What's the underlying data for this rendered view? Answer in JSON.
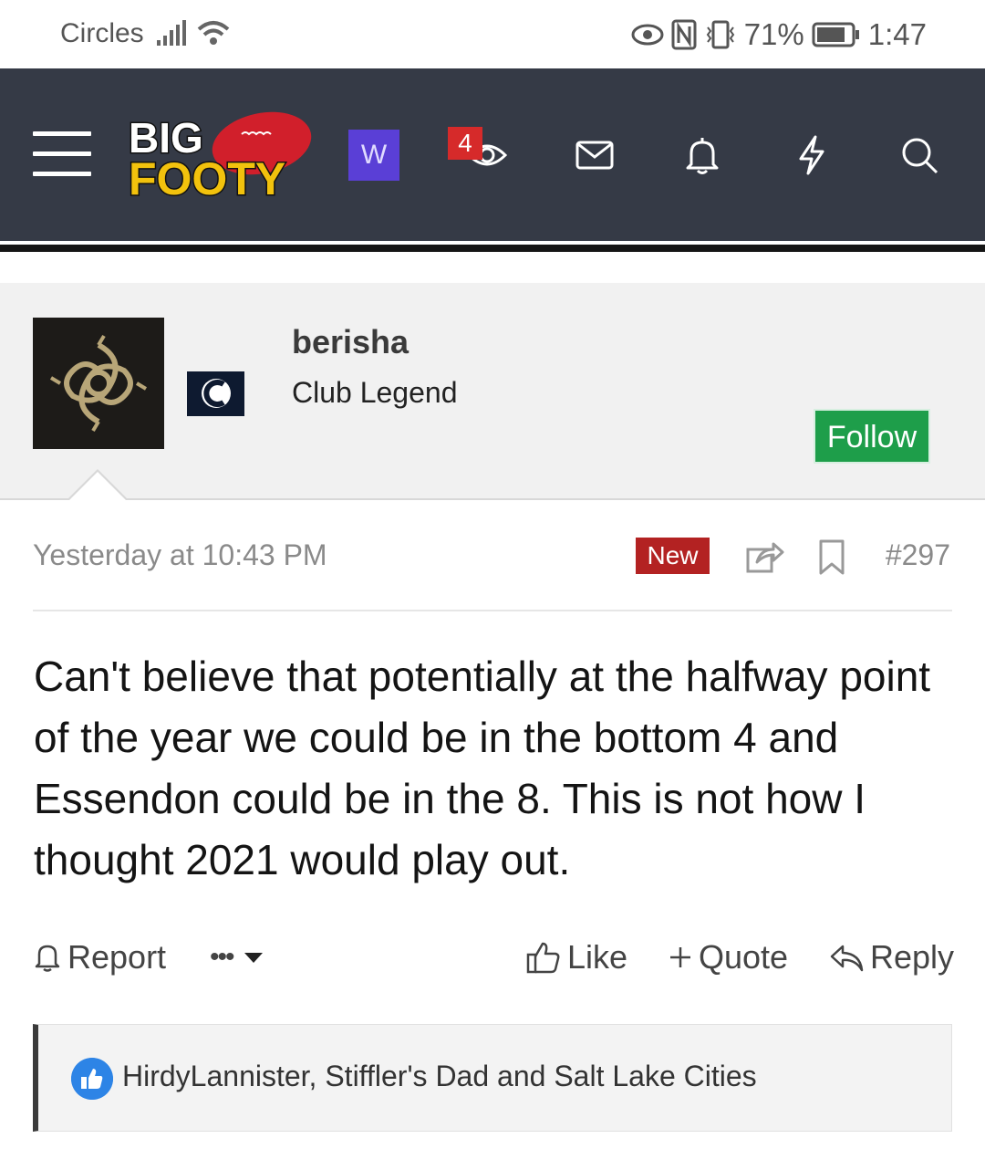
{
  "status_bar": {
    "carrier": "Circles",
    "battery": "71%",
    "time": "1:47"
  },
  "header": {
    "logo_text_top": "BIG",
    "logo_text_bottom": "FOOTY",
    "w_badge": "W",
    "watched_count": "4",
    "icons": [
      "menu-icon",
      "eye-icon",
      "envelope-icon",
      "bell-icon",
      "lightning-icon",
      "search-icon"
    ]
  },
  "user": {
    "name": "berisha",
    "title": "Club Legend",
    "follow_label": "Follow"
  },
  "post": {
    "timestamp": "Yesterday at 10:43 PM",
    "new_label": "New",
    "number": "#297",
    "body": "Can't believe that potentially at the halfway point of the year we could be in the bottom 4 and Essendon could be in the 8. This is not how I thought 2021 would play out."
  },
  "actions": {
    "report": "Report",
    "more": "•••",
    "like": "Like",
    "quote": "Quote",
    "reply": "Reply"
  },
  "reactions": {
    "text": "HirdyLannister, Stiffler's Dad and Salt Lake Cities"
  },
  "colors": {
    "header_bg": "#353a46",
    "follow_green": "#1e9e4a",
    "new_red": "#b32222",
    "badge_red": "#d62a2a",
    "w_purple": "#5a3fd6",
    "like_blue": "#2d84e6"
  }
}
